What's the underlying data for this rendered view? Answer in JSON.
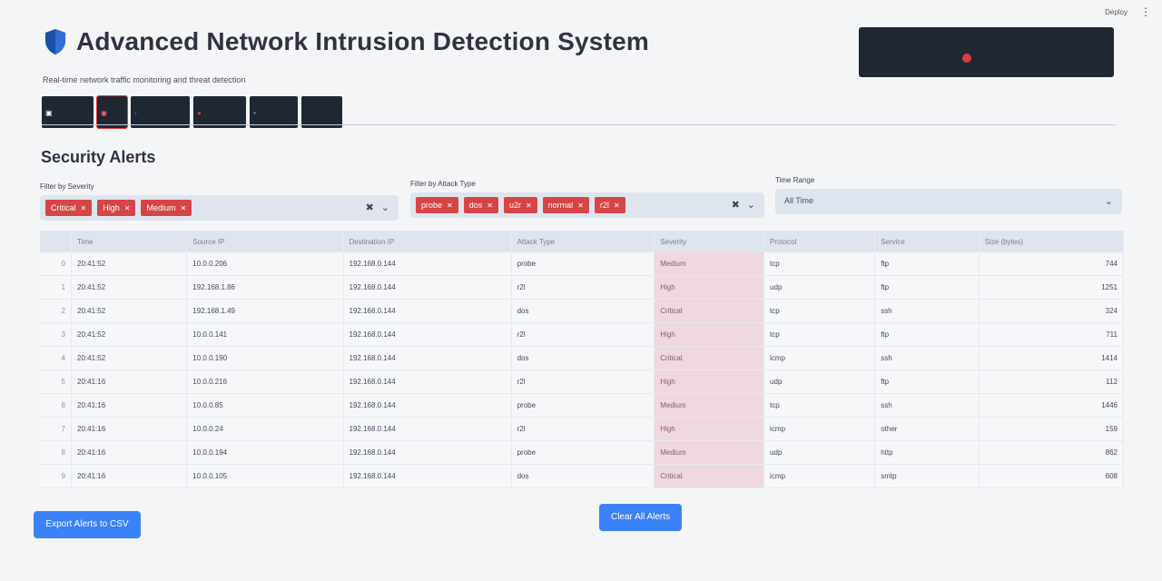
{
  "topbar": {
    "deploy_label": "Deploy",
    "menu_icon": "vertical-dots-icon"
  },
  "header": {
    "icon": "shield-icon",
    "title": "Advanced Network Intrusion Detection System",
    "subtitle": "Real-time network traffic monitoring and threat detection"
  },
  "status_panel": {
    "indicator_color": "#e23a3a"
  },
  "tabs": [
    {
      "icon": "chart-icon"
    },
    {
      "icon": "alert-icon",
      "active": true
    },
    {
      "icon": "chevron-icon"
    },
    {
      "icon": "record-icon"
    },
    {
      "icon": "list-icon"
    },
    {
      "icon": "settings-icon"
    }
  ],
  "section": {
    "title": "Security Alerts"
  },
  "filters": {
    "severity": {
      "label": "Filter by Severity",
      "chips": [
        "Critical",
        "High",
        "Medium"
      ]
    },
    "attack_type": {
      "label": "Filter by Attack Type",
      "chips": [
        "probe",
        "dos",
        "u2r",
        "normal",
        "r2l"
      ]
    },
    "time_range": {
      "label": "Time Range",
      "value": "All Time"
    }
  },
  "table": {
    "columns": [
      "",
      "Time",
      "Source IP",
      "Destination IP",
      "Attack Type",
      "Severity",
      "Protocol",
      "Service",
      "Size (bytes)"
    ],
    "rows": [
      [
        "0",
        "20:41:52",
        "10.0.0.206",
        "192.168.0.144",
        "probe",
        "Medium",
        "tcp",
        "ftp",
        "744"
      ],
      [
        "1",
        "20:41:52",
        "192.168.1.86",
        "192.168.0.144",
        "r2l",
        "High",
        "udp",
        "ftp",
        "1251"
      ],
      [
        "2",
        "20:41:52",
        "192.168.1.49",
        "192.168.0.144",
        "dos",
        "Critical",
        "tcp",
        "ssh",
        "324"
      ],
      [
        "3",
        "20:41:52",
        "10.0.0.141",
        "192.168.0.144",
        "r2l",
        "High",
        "tcp",
        "ftp",
        "711"
      ],
      [
        "4",
        "20:41:52",
        "10.0.0.190",
        "192.168.0.144",
        "dos",
        "Critical",
        "icmp",
        "ssh",
        "1414"
      ],
      [
        "5",
        "20:41:16",
        "10.0.0.216",
        "192.168.0.144",
        "r2l",
        "High",
        "udp",
        "ftp",
        "112"
      ],
      [
        "6",
        "20:41:16",
        "10.0.0.85",
        "192.168.0.144",
        "probe",
        "Medium",
        "tcp",
        "ssh",
        "1446"
      ],
      [
        "7",
        "20:41:16",
        "10.0.0.24",
        "192.168.0.144",
        "r2l",
        "High",
        "icmp",
        "other",
        "159"
      ],
      [
        "8",
        "20:41:16",
        "10.0.0.194",
        "192.168.0.144",
        "probe",
        "Medium",
        "udp",
        "http",
        "862"
      ],
      [
        "9",
        "20:41:16",
        "10.0.0.105",
        "192.168.0.144",
        "dos",
        "Critical",
        "icmp",
        "smtp",
        "608"
      ]
    ]
  },
  "actions": {
    "export_label": "Export Alerts to CSV",
    "clear_label": "Clear All Alerts"
  },
  "colors": {
    "accent": "#3b82f6",
    "chip": "#d64545",
    "dark_panel": "#1f2733"
  }
}
